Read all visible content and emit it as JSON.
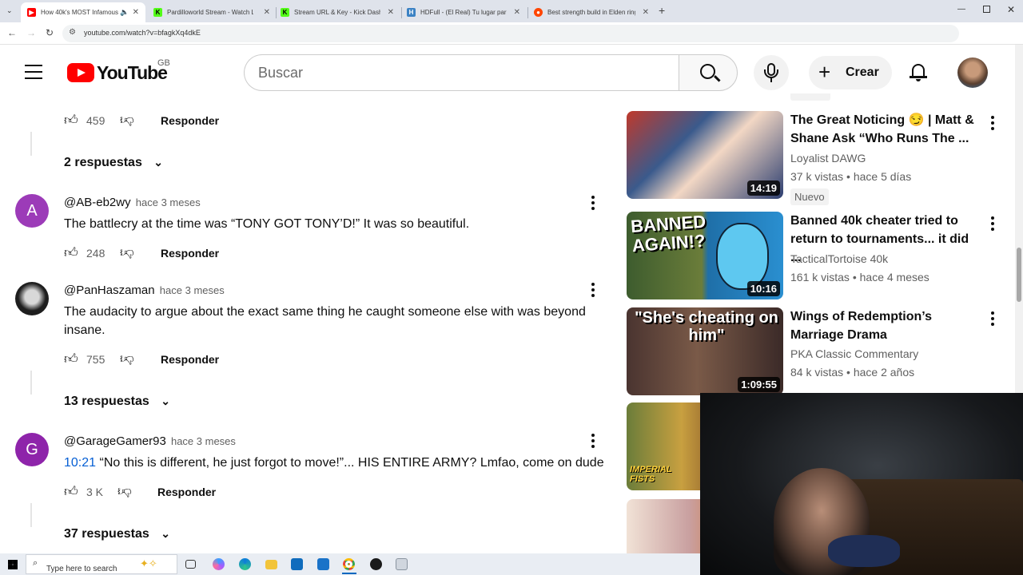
{
  "browser": {
    "tabs": [
      {
        "title": "How 40k's MOST Infamous",
        "fav_color": "#ff0000"
      },
      {
        "title": "Pardilloworld Stream - Watch L",
        "fav_color": "#53fc18"
      },
      {
        "title": "Stream URL & Key - Kick Dashb",
        "fav_color": "#53fc18"
      },
      {
        "title": "HDFull - (El Real) Tu lugar para",
        "fav_color": "#3b82c4"
      },
      {
        "title": "Best strength build in Elden ring",
        "fav_color": "#ff4500"
      }
    ],
    "url": "youtube.com/watch?v=bfagkXq4dkE"
  },
  "youtube": {
    "logo_text": "YouTube",
    "region": "GB",
    "search_placeholder": "Buscar",
    "create_label": "Crear"
  },
  "comments_top": {
    "likes": "459",
    "reply_label": "Responder",
    "replies_label": "2 respuestas"
  },
  "comments": [
    {
      "handle": "@AB-eb2wy",
      "time": "hace 3 meses",
      "avatar_letter": "A",
      "avatar_color": "#9c3bb8",
      "text": "The battlecry at the time was “TONY GOT TONY’D!” It was so beautiful.",
      "likes": "248",
      "reply_label": "Responder"
    },
    {
      "handle": "@PanHaszaman",
      "time": "hace 3 meses",
      "avatar_letter": "",
      "avatar_color": "#2a2a2a",
      "text": "The audacity to argue about the exact same thing he caught someone else with was beyond insane.",
      "likes": "755",
      "reply_label": "Responder",
      "replies_label": "13 respuestas"
    },
    {
      "handle": "@GarageGamer93",
      "time": "hace 3 meses",
      "avatar_letter": "G",
      "avatar_color": "#8e24aa",
      "timestamp_link": "10:21",
      "text": "“No this is different, he just forgot to move!”... HIS ENTIRE ARMY? Lmfao, come on dude",
      "likes": "3 K",
      "reply_label": "Responder",
      "replies_label": "37 respuestas"
    }
  ],
  "recommendations": [
    {
      "title": "The Great Noticing 😏 | Matt & Shane Ask “Who Runs The ...",
      "channel": "Loyalist DAWG",
      "views": "37 k vistas",
      "age": "hace 5 días",
      "badge": "Nuevo",
      "duration": "14:19",
      "thumb_color": "#3a5a8c"
    },
    {
      "title": "Banned 40k cheater tried to return to tournaments... it did ...",
      "channel": "TacticalTortoise 40k",
      "views": "161 k vistas",
      "age": "hace 4 meses",
      "duration": "10:16",
      "thumb_text": "BANNED AGAIN!?",
      "thumb_color": "#2f5f2a"
    },
    {
      "title": "Wings of Redemption’s Marriage Drama",
      "channel": "PKA Classic Commentary",
      "views": "84 k vistas",
      "age": "hace 2 años",
      "duration": "1:09:55",
      "thumb_text": "\"She's cheating on him\"",
      "thumb_color": "#3b2a28"
    },
    {
      "thumb_text": "IMPERIAL FISTS",
      "thumb_color": "#8a5a2a"
    },
    {
      "thumb_color": "#c9a0a0"
    }
  ],
  "taskbar": {
    "search_placeholder": "Type here to search"
  }
}
